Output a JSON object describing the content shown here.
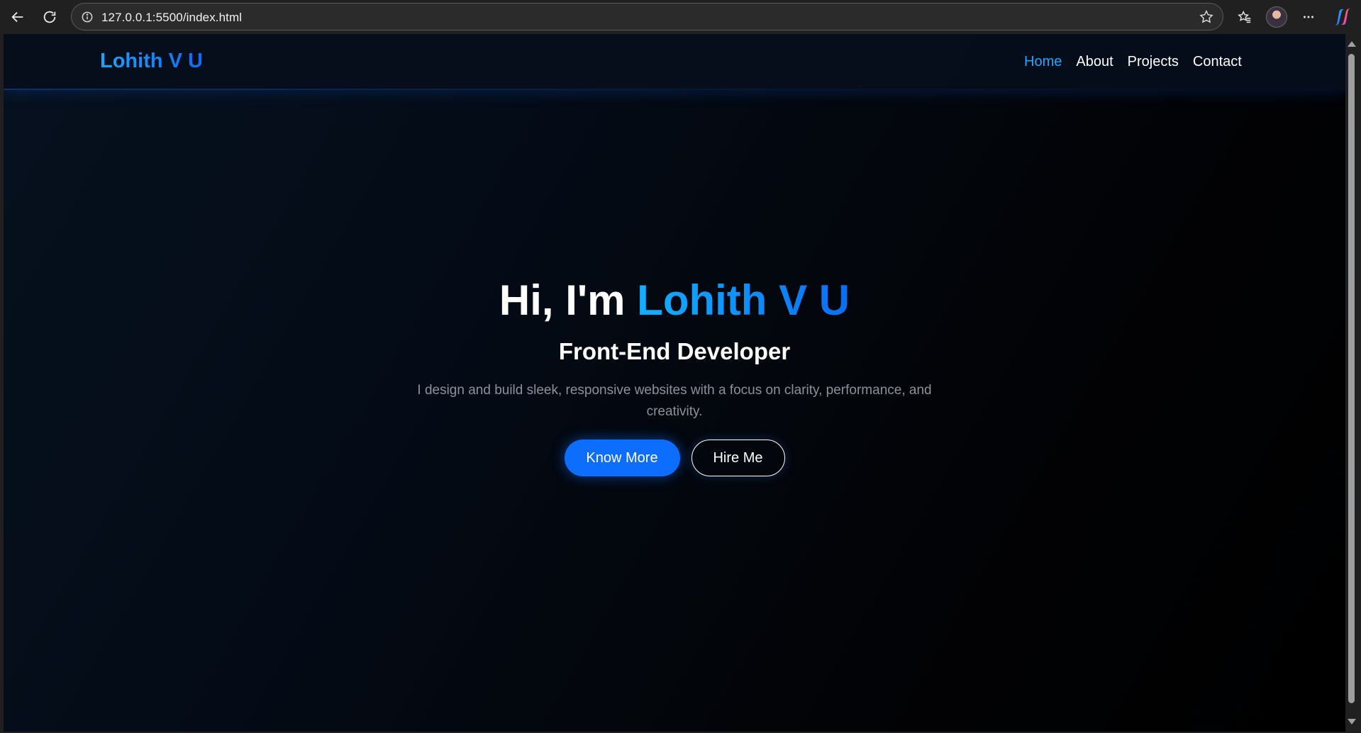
{
  "browser": {
    "url": "127.0.0.1:5500/index.html",
    "icons": [
      "back-icon",
      "refresh-icon",
      "info-icon",
      "star-icon",
      "favorites-icon",
      "profile-avatar",
      "more-icon",
      "copilot-icon"
    ]
  },
  "navbar": {
    "logo": "Lohith V U",
    "links": [
      {
        "label": "Home",
        "active": true
      },
      {
        "label": "About",
        "active": false
      },
      {
        "label": "Projects",
        "active": false
      },
      {
        "label": "Contact",
        "active": false
      }
    ]
  },
  "hero": {
    "greeting": "Hi, I'm ",
    "name": "Lohith V U",
    "subtitle": "Front-End Developer",
    "description": "I design and build sleek, responsive websites with a focus on clarity, performance, and creativity.",
    "primary_button": "Know More",
    "secondary_button": "Hire Me"
  },
  "colors": {
    "accent": "#1ea7ff",
    "primary_button": "#0d6efd",
    "background": "#040b16"
  }
}
